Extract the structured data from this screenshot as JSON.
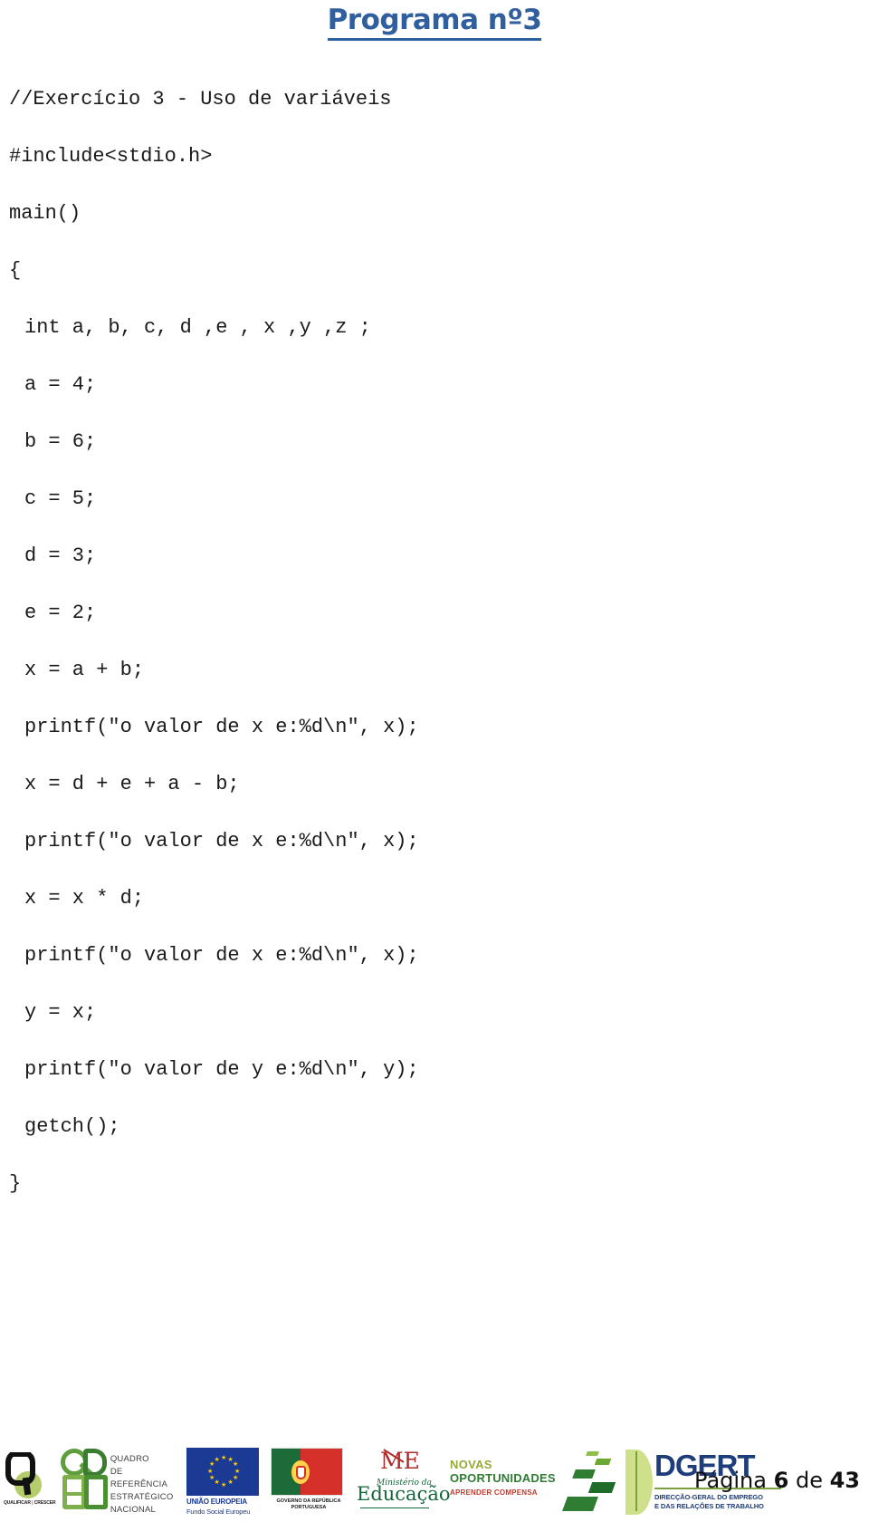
{
  "document": {
    "title": "Programa nº3",
    "language": "pt-PT"
  },
  "code": {
    "language": "c",
    "lines": [
      {
        "indent": 0,
        "text": "//Exercício 3 - Uso de variáveis"
      },
      {
        "indent": 0,
        "text": "#include<stdio.h>"
      },
      {
        "indent": 0,
        "text": "main()"
      },
      {
        "indent": 0,
        "text": "{"
      },
      {
        "indent": 1,
        "text": "int a, b, c, d ,e , x ,y ,z ;"
      },
      {
        "indent": 1,
        "text": "a = 4;"
      },
      {
        "indent": 1,
        "text": "b = 6;"
      },
      {
        "indent": 1,
        "text": "c = 5;"
      },
      {
        "indent": 1,
        "text": "d = 3;"
      },
      {
        "indent": 1,
        "text": "e = 2;"
      },
      {
        "indent": 1,
        "text": "x = a + b;"
      },
      {
        "indent": 1,
        "text": "printf(\"o valor de x e:%d\\n\", x);"
      },
      {
        "indent": 1,
        "text": "x = d + e + a - b;"
      },
      {
        "indent": 1,
        "text": "printf(\"o valor de x e:%d\\n\", x);"
      },
      {
        "indent": 1,
        "text": "x = x * d;"
      },
      {
        "indent": 1,
        "text": "printf(\"o valor de x e:%d\\n\", x);"
      },
      {
        "indent": 1,
        "text": "y = x;"
      },
      {
        "indent": 1,
        "text": "printf(\"o valor de y e:%d\\n\", y);"
      },
      {
        "indent": 1,
        "text": "getch();"
      },
      {
        "indent": 0,
        "text": "}"
      }
    ]
  },
  "footer": {
    "page_label": "Página",
    "page_current": "6",
    "page_of": "de",
    "page_total": "43",
    "page_text": "Página 6 de 43",
    "logos": [
      {
        "name": "poph",
        "tagline_main": "QUALIFICAR",
        "tagline_sep": "É",
        "tagline_end": "CRESCER"
      },
      {
        "name": "qren",
        "acronym": "QREN",
        "line1": "QUADRO",
        "line2": "DE REFERÊNCIA",
        "line3": "ESTRATÉGICO",
        "line4": "NACIONAL"
      },
      {
        "name": "european-union",
        "caption1": "UNIÃO EUROPEIA",
        "caption2": "Fundo Social Europeu"
      },
      {
        "name": "portuguese-republic",
        "caption1": "GOVERNO DA REPÚBLICA",
        "caption2": "PORTUGUESA"
      },
      {
        "name": "ministerio-da-educacao",
        "mark": "ME",
        "caption1": "Ministério da",
        "caption2": "Educação"
      },
      {
        "name": "novas-oportunidades",
        "line1": "NOVAS",
        "line2": "OPORTUNIDADES",
        "line3": "APRENDER COMPENSA"
      },
      {
        "name": "dgert",
        "acronym": "DGERT",
        "caption1": "DIRECÇÃO-GERAL DO EMPREGO",
        "caption2": "E DAS RELAÇÕES DE TRABALHO"
      }
    ]
  },
  "colors": {
    "title": "#2f5f9e",
    "code_text": "#1a1a1a",
    "page_background": "#ffffff",
    "qren_green": "#5f9e3d",
    "eu_blue": "#1b3a93",
    "eu_star_yellow": "#ffcc00",
    "pt_green": "#1e6b3a",
    "pt_red": "#d6302a",
    "me_red": "#b02a2a",
    "me_green": "#15663a",
    "no_olive": "#9aa83a",
    "no_green": "#2e7d32",
    "no_red": "#c0392b",
    "dgert_blue": "#1f3d7a",
    "dgert_leaf": "#cfe08a"
  }
}
